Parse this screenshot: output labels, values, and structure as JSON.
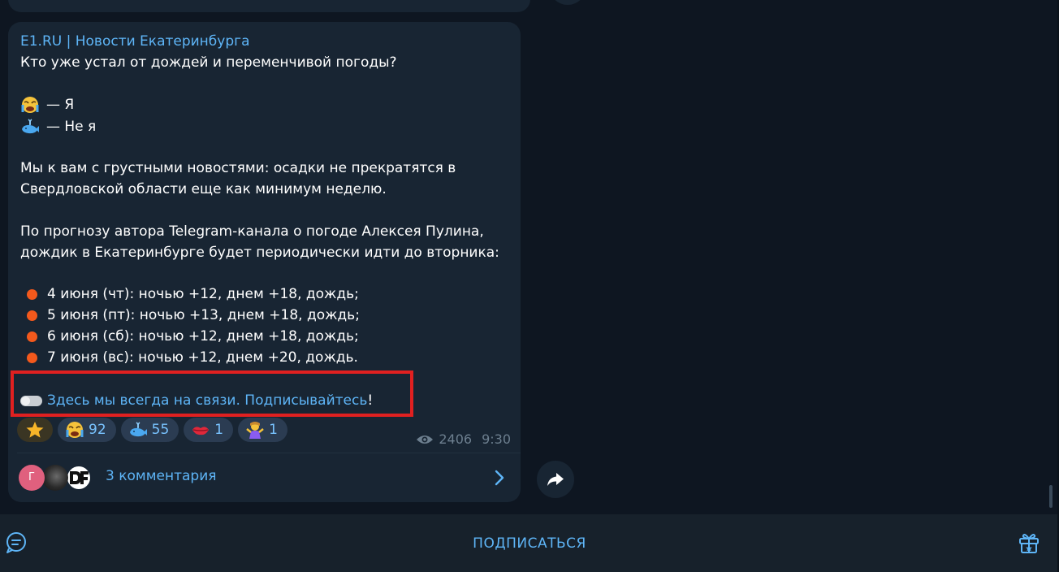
{
  "message": {
    "channel_title": "E1.RU | Новости Екатеринбурга",
    "lines": {
      "question": "Кто уже устал от дождей и переменчивой погоды?",
      "option_me": "— Я",
      "option_not_me": "— Не я",
      "p1_l1": "Мы к вам с грустными новостями: осадки не прекратятся в",
      "p1_l2": "Свердловской области еще как минимум неделю.",
      "p2_l1": "По прогнозу автора Telegram-канала о погоде Алексея Пулина,",
      "p2_l2": "дождик в Екатеринбурге будет периодически идти до вторника:"
    },
    "forecast": [
      "4 июня (чт): ночью +12, днем +18, дождь;",
      "5 июня (пт): ночью +13, днем +18, дождь;",
      "6 июня (сб): ночью +12, днем +18, дождь;",
      "7 июня (вс): ночью +12, днем +20, дождь."
    ],
    "subscribe_link": "Здесь мы всегда на связи. Подписывайтесь",
    "subscribe_suffix": "!",
    "reactions": [
      {
        "emoji": "star-icon",
        "count": ""
      },
      {
        "emoji": "crying-face-icon",
        "count": "92"
      },
      {
        "emoji": "whale-icon",
        "count": "55"
      },
      {
        "emoji": "kiss-lips-icon",
        "count": "1"
      },
      {
        "emoji": "shrug-icon",
        "count": "1"
      }
    ],
    "views": "2406",
    "time": "9:30",
    "comments_avatar_letter": "Г",
    "comments_label": "3 комментария"
  },
  "bottom_bar": {
    "subscribe_label": "ПОДПИСАТЬСЯ"
  },
  "colors": {
    "background": "#0e1621",
    "bubble": "#182533",
    "accent": "#5eb5f7",
    "bullet": "#f4591c",
    "highlight": "#e02020"
  }
}
